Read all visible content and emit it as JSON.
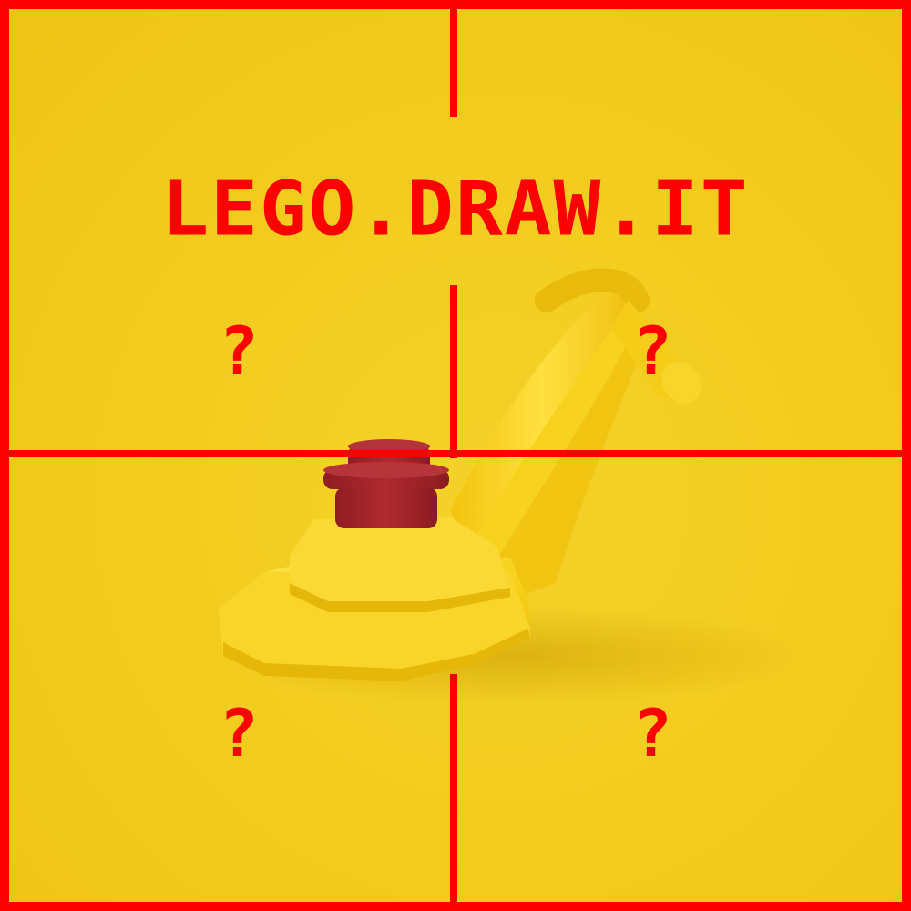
{
  "title": "LEGO.DRAW.IT",
  "quadrants": {
    "top_left": "?",
    "top_right": "?",
    "bottom_left": "?",
    "bottom_right": "?"
  },
  "brick": {
    "description_icon": "lego-banana-brick-icon",
    "colors": {
      "body": "#f7d21a",
      "stud": "#a3252b"
    }
  },
  "colors": {
    "background": "#f2cb1c",
    "accent": "#ff0000"
  }
}
